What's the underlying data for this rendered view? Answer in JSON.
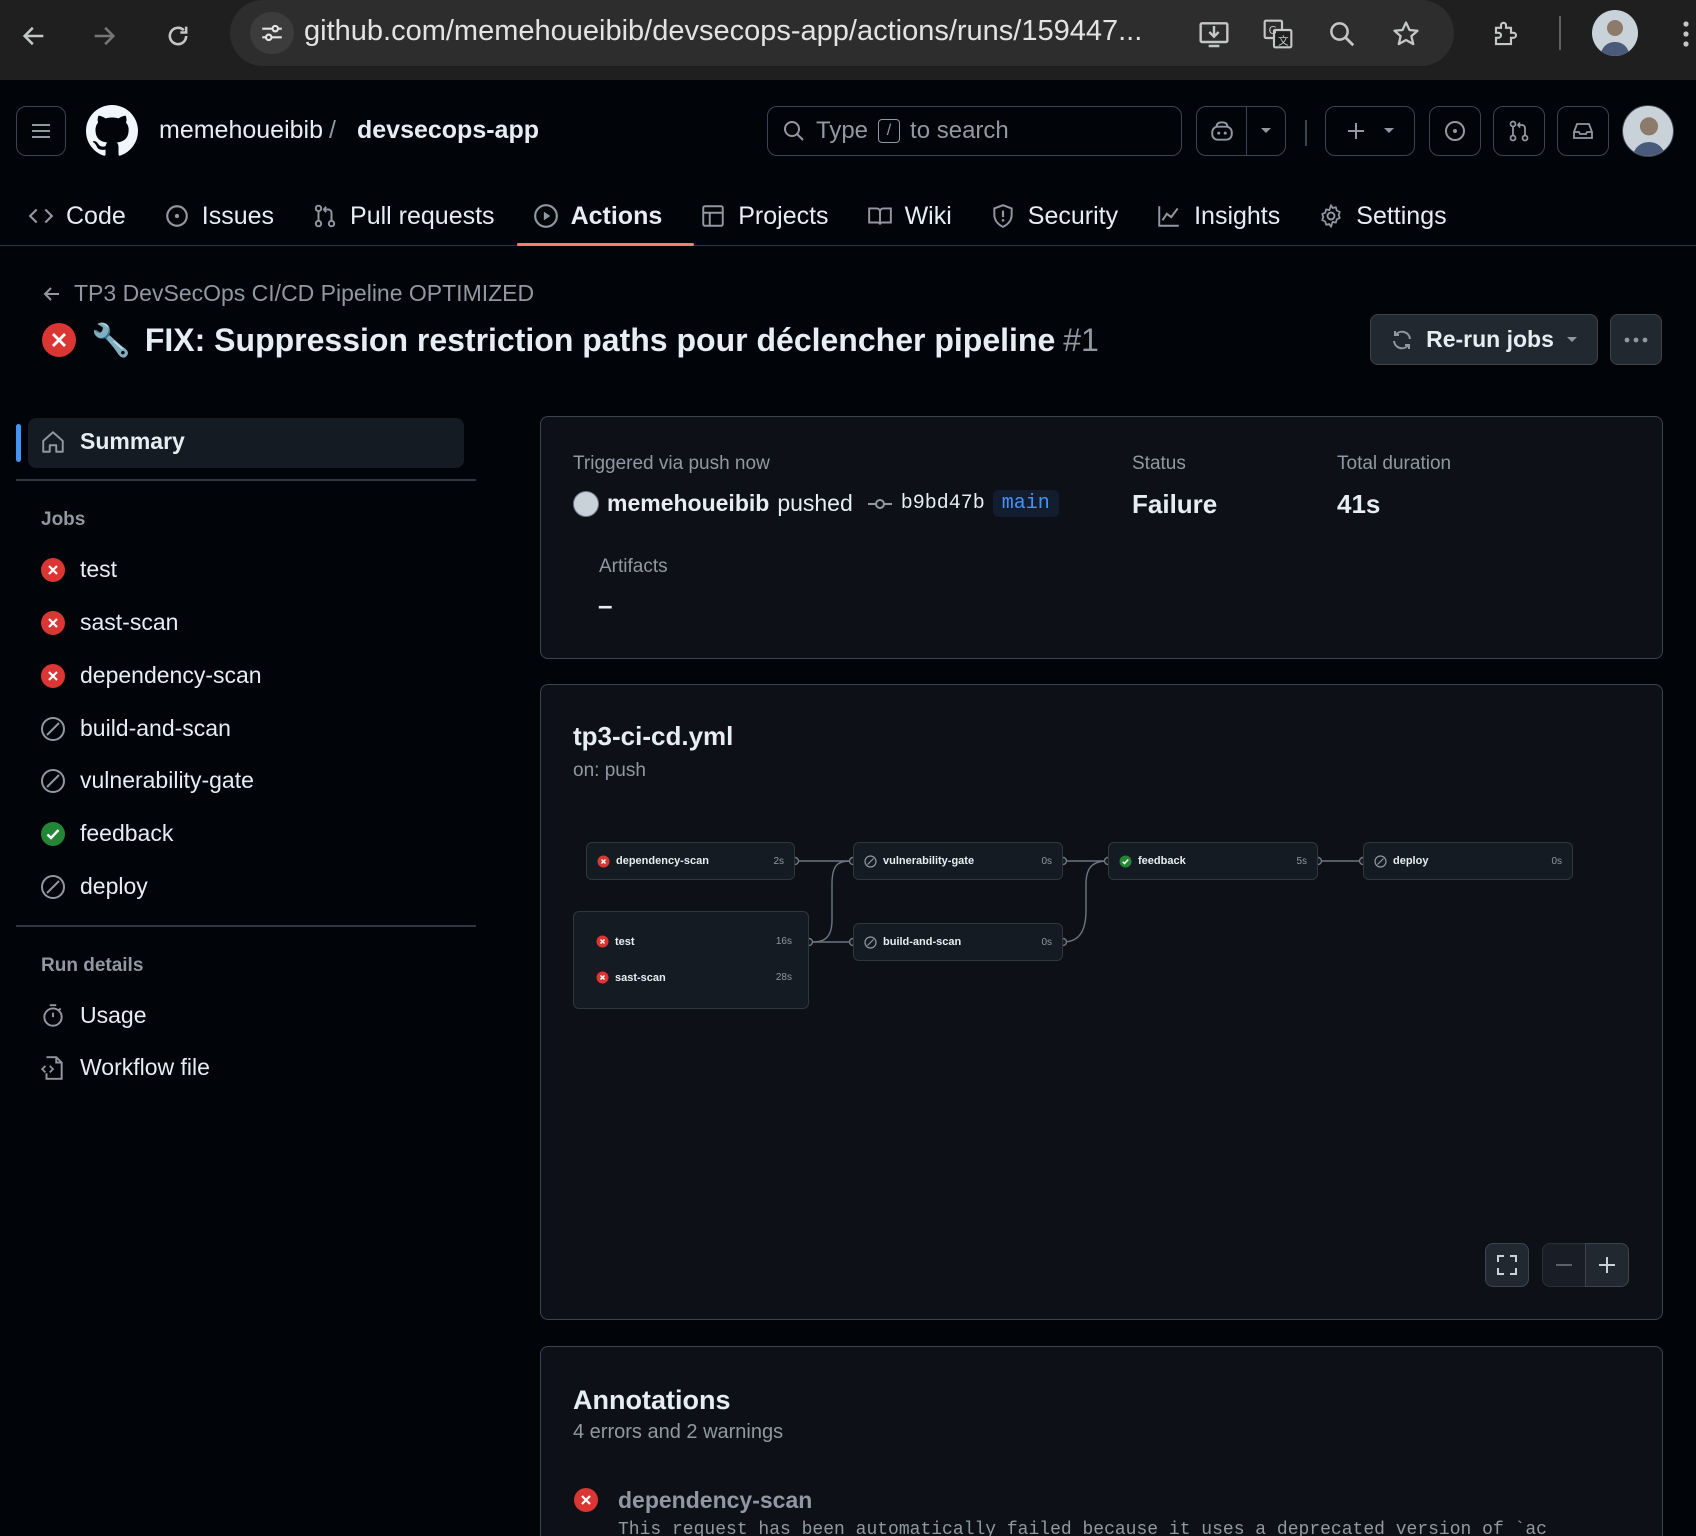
{
  "browser": {
    "url": "github.com/memehoueibib/devsecops-app/actions/runs/159447..."
  },
  "header": {
    "owner": "memehoueibib",
    "separator": "/",
    "repo": "devsecops-app",
    "search_prefix": "Type",
    "search_key": "/",
    "search_suffix": "to search"
  },
  "tabs": [
    {
      "label": "Code",
      "icon": "code-icon"
    },
    {
      "label": "Issues",
      "icon": "issue-icon"
    },
    {
      "label": "Pull requests",
      "icon": "pull-request-icon"
    },
    {
      "label": "Actions",
      "icon": "play-icon",
      "active": true
    },
    {
      "label": "Projects",
      "icon": "table-icon"
    },
    {
      "label": "Wiki",
      "icon": "book-icon"
    },
    {
      "label": "Security",
      "icon": "shield-icon"
    },
    {
      "label": "Insights",
      "icon": "graph-icon"
    },
    {
      "label": "Settings",
      "icon": "gear-icon"
    }
  ],
  "run": {
    "back_label": "TP3 DevSecOps CI/CD Pipeline OPTIMIZED",
    "emoji": "🔧",
    "title": "FIX: Suppression restriction paths pour déclencher pipeline",
    "number": "#1",
    "rerun_label": "Re-run jobs"
  },
  "sidebar": {
    "summary_label": "Summary",
    "jobs_heading": "Jobs",
    "jobs": [
      {
        "label": "test",
        "status": "failure"
      },
      {
        "label": "sast-scan",
        "status": "failure"
      },
      {
        "label": "dependency-scan",
        "status": "failure"
      },
      {
        "label": "build-and-scan",
        "status": "skipped"
      },
      {
        "label": "vulnerability-gate",
        "status": "skipped"
      },
      {
        "label": "feedback",
        "status": "success"
      },
      {
        "label": "deploy",
        "status": "skipped"
      }
    ],
    "run_details_heading": "Run details",
    "usage_label": "Usage",
    "workflow_file_label": "Workflow file"
  },
  "summary": {
    "trigger_label": "Triggered via push now",
    "actor": "memehoueibib",
    "action": "pushed",
    "commit": "b9bd47b",
    "branch": "main",
    "status_label": "Status",
    "status_value": "Failure",
    "duration_label": "Total duration",
    "duration_value": "41s",
    "artifacts_label": "Artifacts",
    "artifacts_value": "–"
  },
  "workflow": {
    "filename": "tp3-ci-cd.yml",
    "trigger": "on: push",
    "nodes": {
      "dependency_scan": {
        "label": "dependency-scan",
        "duration": "2s",
        "status": "failure"
      },
      "vulnerability_gate": {
        "label": "vulnerability-gate",
        "duration": "0s",
        "status": "skipped"
      },
      "feedback": {
        "label": "feedback",
        "duration": "5s",
        "status": "success"
      },
      "deploy": {
        "label": "deploy",
        "duration": "0s",
        "status": "skipped"
      },
      "test": {
        "label": "test",
        "duration": "16s",
        "status": "failure"
      },
      "sast_scan": {
        "label": "sast-scan",
        "duration": "28s",
        "status": "failure"
      },
      "build_and_scan": {
        "label": "build-and-scan",
        "duration": "0s",
        "status": "skipped"
      }
    }
  },
  "annotations": {
    "title": "Annotations",
    "subtitle": "4 errors and 2 warnings",
    "first_job": "dependency-scan",
    "first_message": "This request has been automatically failed because it uses a deprecated version of `ac"
  },
  "colors": {
    "failure": "#da3633",
    "success": "#238636",
    "accent": "#f78166",
    "link": "#4493f8"
  }
}
